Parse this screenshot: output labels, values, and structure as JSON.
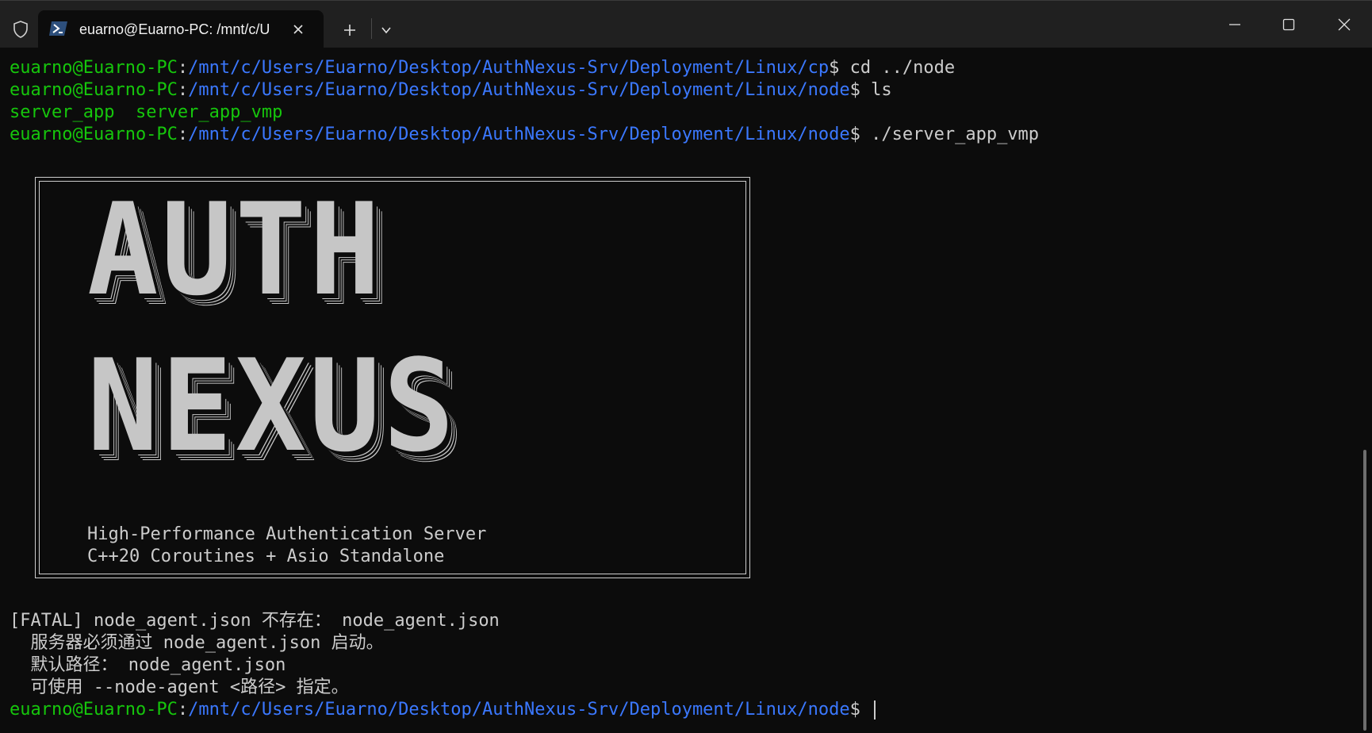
{
  "tab": {
    "title": "euarno@Euarno-PC: /mnt/c/U"
  },
  "icons": {
    "shield": "shield-icon",
    "terminal": "powershell-icon",
    "close": "close-icon",
    "new_tab": "plus-icon",
    "dropdown": "chevron-down-icon",
    "minimize": "minimize-icon",
    "maximize": "maximize-icon",
    "window_close": "close-icon"
  },
  "colors": {
    "background": "#0c0c0c",
    "user": "#16c60c",
    "path": "#3b78ff",
    "text": "#cccccc"
  },
  "terminal": {
    "lines": [
      {
        "user": "euarno@Euarno-PC",
        "sep": ":",
        "path": "/mnt/c/Users/Euarno/Desktop/AuthNexus-Srv/Deployment/Linux/cp",
        "prompt": "$ ",
        "cmd": "cd ../node"
      },
      {
        "user": "euarno@Euarno-PC",
        "sep": ":",
        "path": "/mnt/c/Users/Euarno/Desktop/AuthNexus-Srv/Deployment/Linux/node",
        "prompt": "$ ",
        "cmd": "ls"
      },
      {
        "files": [
          "server_app",
          "server_app_vmp"
        ]
      },
      {
        "user": "euarno@Euarno-PC",
        "sep": ":",
        "path": "/mnt/c/Users/Euarno/Desktop/AuthNexus-Srv/Deployment/Linux/node",
        "prompt": "$ ",
        "cmd": "./server_app_vmp"
      }
    ],
    "banner": {
      "line1": "AUTH",
      "line2": "NEXUS",
      "tagline1": "High-Performance Authentication Server",
      "tagline2": "C++20 Coroutines + Asio Standalone"
    },
    "errors": [
      "[FATAL] node_agent.json 不存在： node_agent.json",
      "  服务器必须通过 node_agent.json 启动。",
      "  默认路径： node_agent.json",
      "  可使用 --node-agent <路径> 指定。"
    ],
    "last_prompt": {
      "user": "euarno@Euarno-PC",
      "sep": ":",
      "path": "/mnt/c/Users/Euarno/Desktop/AuthNexus-Srv/Deployment/Linux/node",
      "prompt": "$ "
    }
  }
}
